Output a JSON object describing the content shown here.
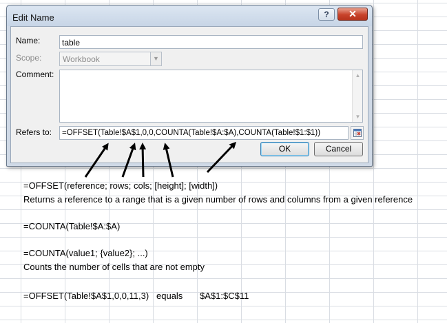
{
  "dialog": {
    "title": "Edit Name",
    "help_label": "?",
    "close_label": "✕",
    "name_label": "Name:",
    "name_value": "table",
    "scope_label": "Scope:",
    "scope_value": "Workbook",
    "comment_label": "Comment:",
    "comment_value": "",
    "refers_label": "Refers to:",
    "refers_value": "=OFFSET(Table!$A$1,0,0,COUNTA(Table!$A:$A),COUNTA(Table!$1:$1))",
    "ok_label": "OK",
    "cancel_label": "Cancel"
  },
  "notes": {
    "offset_syntax": "=OFFSET(reference; rows; cols; [height]; [width])",
    "offset_description": "Returns a reference to a range that is a given number of rows and columns from a given reference",
    "counta_example": "=COUNTA(Table!$A:$A)",
    "counta_syntax": "=COUNTA(value1; {value2}; ...)",
    "counta_description": "Counts the number of cells that are not empty",
    "offset_example": "=OFFSET(Table!$A$1,0,0,11,3)",
    "offset_example_equals": "equals",
    "offset_example_result": "$A$1:$C$11"
  },
  "colors": {
    "dialog_frame": "#cfd9e6",
    "sheet_grid": "#d9dde3",
    "close_button": "#c8432b",
    "arrow": "#000000"
  },
  "icons": {
    "help": "question-mark",
    "close": "x-icon",
    "scope_dropdown": "chevron-down-icon",
    "collapse_dialog": "range-select-icon"
  }
}
